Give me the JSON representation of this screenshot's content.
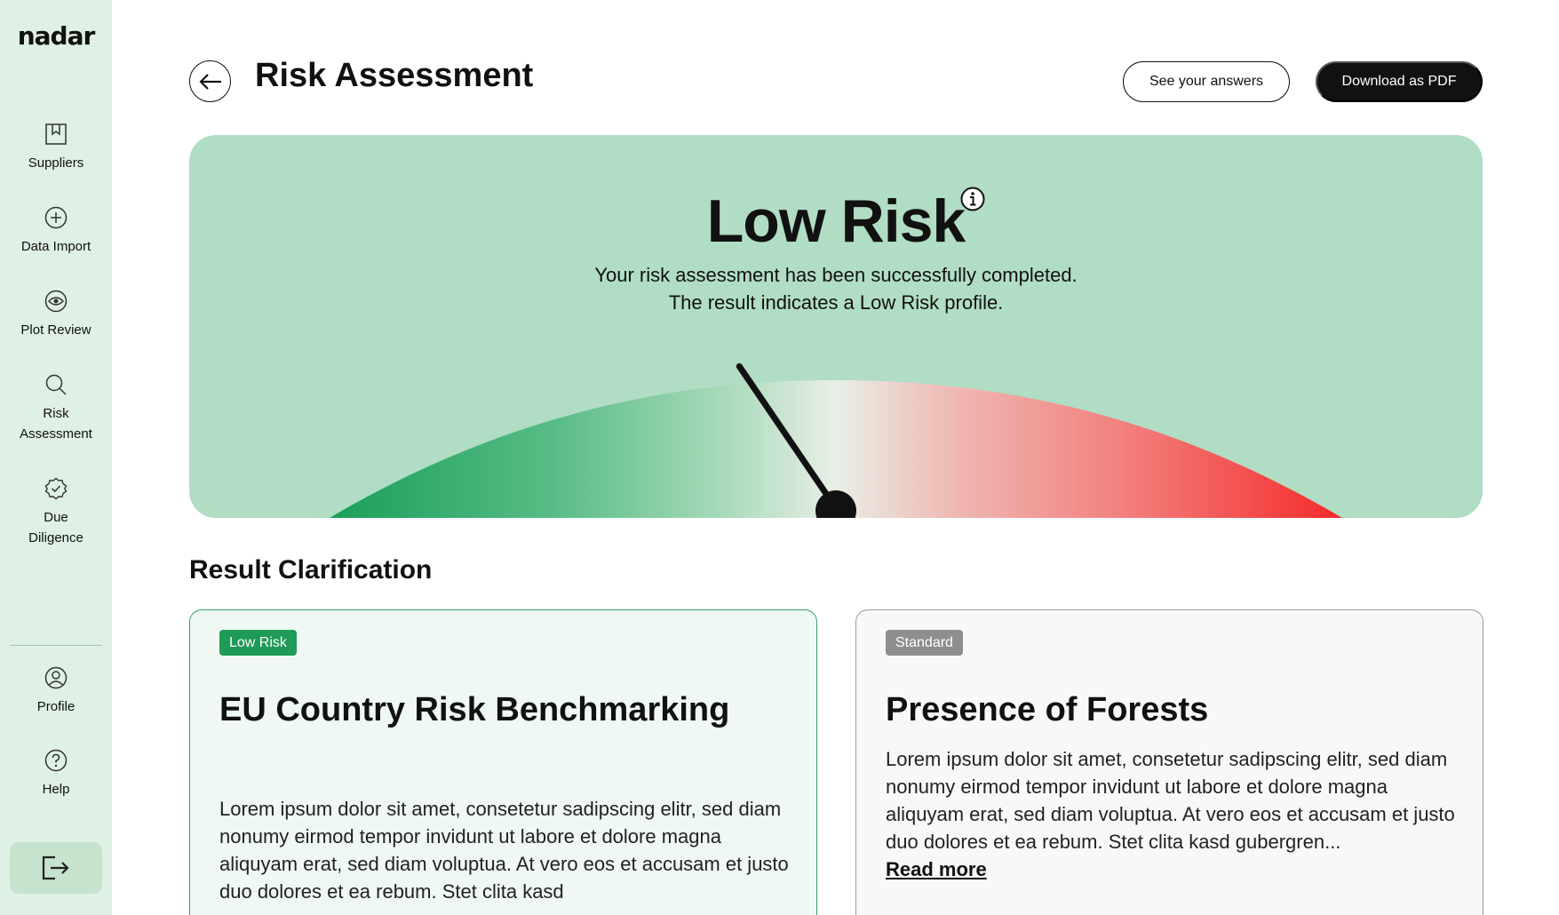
{
  "app": {
    "logo": "nadar"
  },
  "sidebar": {
    "items": [
      {
        "label": "Suppliers",
        "icon": "bookmark-icon"
      },
      {
        "label": "Data Import",
        "icon": "plus-circle-icon"
      },
      {
        "label": "Plot Review",
        "icon": "eye-icon"
      },
      {
        "label": "Risk\nAssessment",
        "icon": "search-icon"
      },
      {
        "label": "Due\nDiligence",
        "icon": "check-badge-icon"
      }
    ],
    "bottom": [
      {
        "label": "Profile",
        "icon": "user-circle-icon"
      },
      {
        "label": "Help",
        "icon": "help-circle-icon"
      }
    ],
    "logout_icon": "logout-icon"
  },
  "header": {
    "title": "Risk Assessment",
    "see_answers_label": "See your answers",
    "download_label": "Download as PDF"
  },
  "hero": {
    "title": "Low Risk",
    "line1": "Your risk assessment has been successfully completed.",
    "line2": "The result indicates a Low Risk profile.",
    "gauge_level": 0.3,
    "colors": {
      "low": "#1a9e5a",
      "mid": "#e8efe6",
      "high": "#f52a2a",
      "background": "#b0ddc3"
    }
  },
  "section": {
    "title": "Result Clarification"
  },
  "cards": [
    {
      "badge": "Low Risk",
      "title": "EU Country Risk Benchmarking",
      "body": "Lorem ipsum dolor sit amet, consetetur sadipscing elitr, sed diam nonumy eirmod tempor invidunt ut labore et dolore magna aliquyam erat, sed diam voluptua. At vero eos et accusam et justo duo dolores et ea rebum. Stet clita kasd"
    },
    {
      "badge": "Standard",
      "title": "Presence of Forests",
      "body": "Lorem ipsum dolor sit amet, consetetur sadipscing elitr, sed diam nonumy eirmod tempor invidunt ut labore et dolore magna aliquyam erat, sed diam voluptua. At vero eos et accusam et justo duo dolores et ea rebum. Stet clita kasd gubergren...",
      "read_more": "Read more"
    }
  ]
}
